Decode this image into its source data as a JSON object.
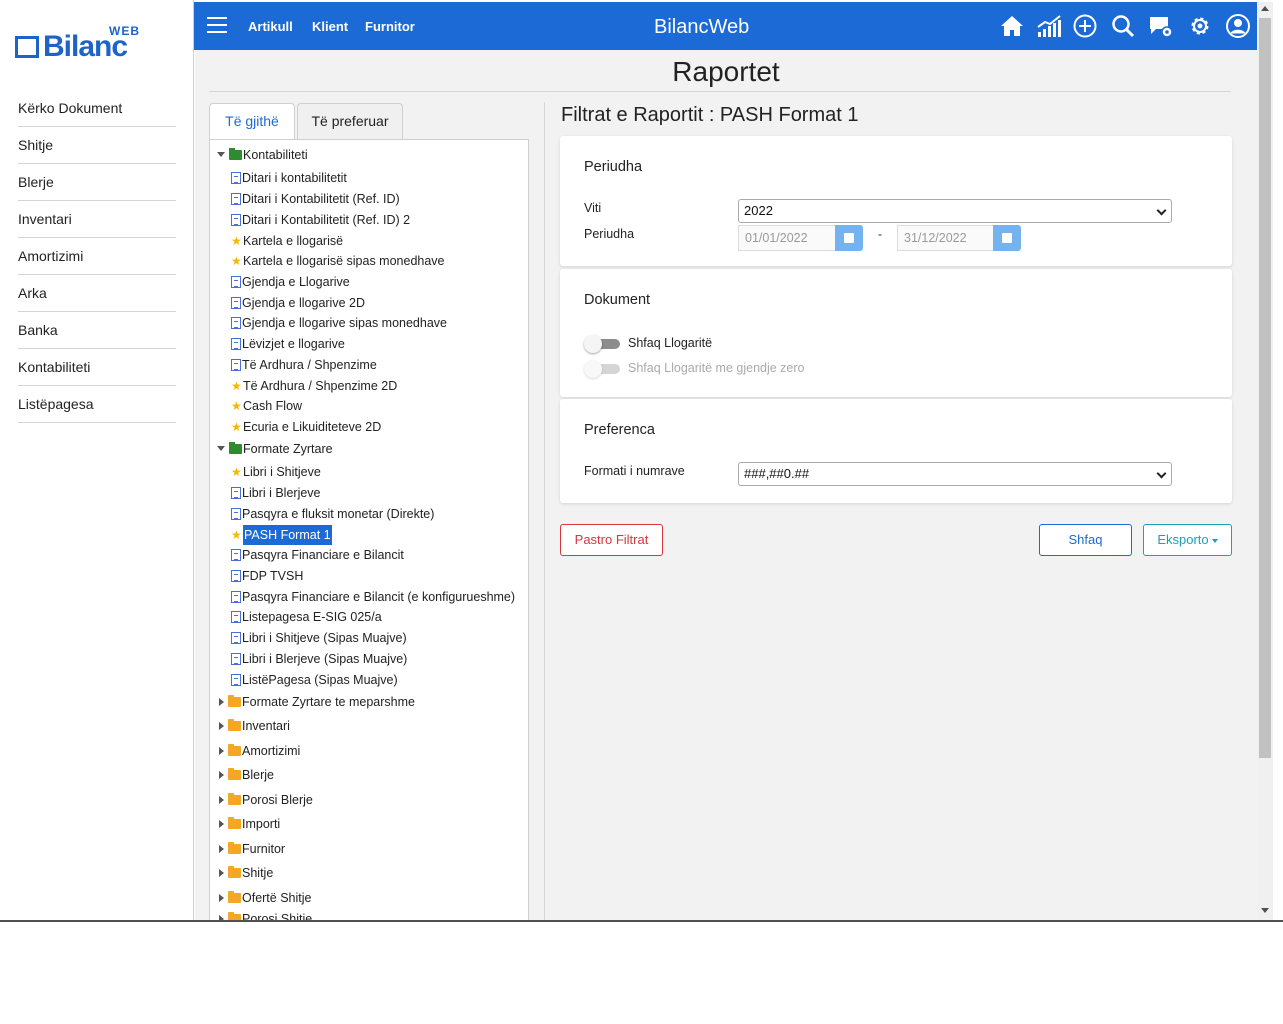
{
  "brand": {
    "logo_web": "WEB",
    "logo_word": "Bilanc",
    "accent": "#1c6ad6"
  },
  "sidebar": {
    "items": [
      "Kërko Dokument",
      "Shitje",
      "Blerje",
      "Inventari",
      "Amortizimi",
      "Arka",
      "Banka",
      "Kontabiliteti",
      "Listëpagesa"
    ]
  },
  "topbar": {
    "menu_icon": "hamburger-icon",
    "links": [
      "Artikull",
      "Klient",
      "Furnitor"
    ],
    "title": "BilancWeb",
    "icons": [
      "home-icon",
      "chart-icon",
      "plus-circle-icon",
      "search-icon",
      "message-settings-icon",
      "gear-icon",
      "user-icon"
    ]
  },
  "page": {
    "title": "Raportet"
  },
  "tabs": {
    "all": "Të gjithë",
    "favorites": "Të preferuar"
  },
  "tree": [
    {
      "level": 0,
      "type": "folder-open",
      "expanded": true,
      "label": "Kontabiliteti"
    },
    {
      "level": 1,
      "type": "doc",
      "label": "Ditari i kontabilitetit"
    },
    {
      "level": 1,
      "type": "doc",
      "label": "Ditari i Kontabilitetit (Ref. ID)"
    },
    {
      "level": 1,
      "type": "doc",
      "label": "Ditari i Kontabilitetit (Ref. ID) 2"
    },
    {
      "level": 1,
      "type": "star",
      "label": "Kartela e llogarisë"
    },
    {
      "level": 1,
      "type": "star",
      "label": "Kartela e llogarisë sipas monedhave"
    },
    {
      "level": 1,
      "type": "doc",
      "label": "Gjendja e Llogarive"
    },
    {
      "level": 1,
      "type": "doc",
      "label": "Gjendja e llogarive 2D"
    },
    {
      "level": 1,
      "type": "doc",
      "label": "Gjendja e llogarive sipas monedhave"
    },
    {
      "level": 1,
      "type": "doc",
      "label": "Lëvizjet e llogarive"
    },
    {
      "level": 1,
      "type": "doc",
      "label": "Të Ardhura / Shpenzime"
    },
    {
      "level": 1,
      "type": "star",
      "label": "Të Ardhura / Shpenzime 2D"
    },
    {
      "level": 1,
      "type": "star",
      "label": "Cash Flow"
    },
    {
      "level": 1,
      "type": "star",
      "label": "Ecuria e Likuiditeteve 2D"
    },
    {
      "level": 0,
      "type": "folder-open",
      "expanded": true,
      "label": "Formate Zyrtare"
    },
    {
      "level": 1,
      "type": "star",
      "label": "Libri i Shitjeve"
    },
    {
      "level": 1,
      "type": "doc",
      "label": "Libri i Blerjeve"
    },
    {
      "level": 1,
      "type": "doc",
      "label": "Pasqyra e fluksit monetar (Direkte)"
    },
    {
      "level": 1,
      "type": "star",
      "label": "PASH Format 1",
      "selected": true
    },
    {
      "level": 1,
      "type": "doc",
      "label": "Pasqyra Financiare e Bilancit"
    },
    {
      "level": 1,
      "type": "doc",
      "label": "FDP TVSH"
    },
    {
      "level": 1,
      "type": "doc",
      "label": "Pasqyra Financiare e Bilancit (e konfigurueshme)"
    },
    {
      "level": 1,
      "type": "doc",
      "label": "Listepagesa E-SIG 025/a"
    },
    {
      "level": 1,
      "type": "doc",
      "label": "Libri i Shitjeve (Sipas Muajve)"
    },
    {
      "level": 1,
      "type": "doc",
      "label": "Libri i Blerjeve (Sipas Muajve)"
    },
    {
      "level": 1,
      "type": "doc",
      "label": "ListëPagesa (Sipas Muajve)"
    },
    {
      "level": 0,
      "type": "folder",
      "expanded": false,
      "label": "Formate Zyrtare te meparshme"
    },
    {
      "level": 0,
      "type": "folder",
      "expanded": false,
      "label": "Inventari"
    },
    {
      "level": 0,
      "type": "folder",
      "expanded": false,
      "label": "Amortizimi"
    },
    {
      "level": 0,
      "type": "folder",
      "expanded": false,
      "label": "Blerje"
    },
    {
      "level": 0,
      "type": "folder",
      "expanded": false,
      "label": "Porosi Blerje"
    },
    {
      "level": 0,
      "type": "folder",
      "expanded": false,
      "label": "Importi"
    },
    {
      "level": 0,
      "type": "folder",
      "expanded": false,
      "label": "Furnitor"
    },
    {
      "level": 0,
      "type": "folder",
      "expanded": false,
      "label": "Shitje"
    },
    {
      "level": 0,
      "type": "folder",
      "expanded": false,
      "label": "Ofertë Shitje"
    },
    {
      "level": 0,
      "type": "folder",
      "expanded": false,
      "label": "Porosi Shitje"
    }
  ],
  "filters": {
    "title": "Filtrat e Raportit : PASH Format 1",
    "period": {
      "title": "Periudha",
      "year_label": "Viti",
      "year_value": "2022",
      "period_label": "Periudha",
      "date_from": "01/01/2022",
      "separator": "-",
      "date_to": "31/12/2022"
    },
    "document": {
      "title": "Dokument",
      "show_accounts": "Shfaq Llogaritë",
      "show_zero_accounts": "Shfaq Llogaritë me gjendje zero"
    },
    "preference": {
      "title": "Preferenca",
      "number_format_label": "Formati i numrave",
      "number_format_value": "###,##0.##"
    }
  },
  "actions": {
    "clear": "Pastro Filtrat",
    "show": "Shfaq",
    "export": "Eksporto"
  }
}
